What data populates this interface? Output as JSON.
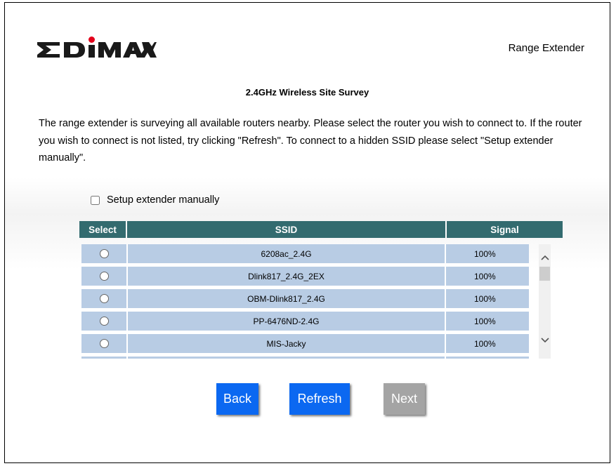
{
  "header": {
    "logo_text": "EDIMAX",
    "product": "Range Extender"
  },
  "page": {
    "title": "2.4GHz Wireless Site Survey",
    "description": "The range extender is surveying all available routers nearby. Please select the router you wish to connect to. If the router you wish to connect is not listed, try clicking \"Refresh\". To connect to a hidden SSID please select \"Setup extender manually\"."
  },
  "manual": {
    "label": "Setup extender manually",
    "checked": false
  },
  "table": {
    "headers": [
      "Select",
      "SSID",
      "Signal"
    ],
    "rows": [
      {
        "ssid": "6208ac_2.4G",
        "signal": "100%"
      },
      {
        "ssid": "Dlink817_2.4G_2EX",
        "signal": "100%"
      },
      {
        "ssid": "OBM-Dlink817_2.4G",
        "signal": "100%"
      },
      {
        "ssid": "PP-6476ND-2.4G",
        "signal": "100%"
      },
      {
        "ssid": "MIS-Jacky",
        "signal": "100%"
      }
    ]
  },
  "buttons": {
    "back": "Back",
    "refresh": "Refresh",
    "next": "Next"
  },
  "colors": {
    "header_bg": "#336b6f",
    "row_bg": "#b8cce4",
    "button_blue": "#0b68f1",
    "button_disabled": "#a4a4a4",
    "logo_dot": "#e3001b"
  }
}
